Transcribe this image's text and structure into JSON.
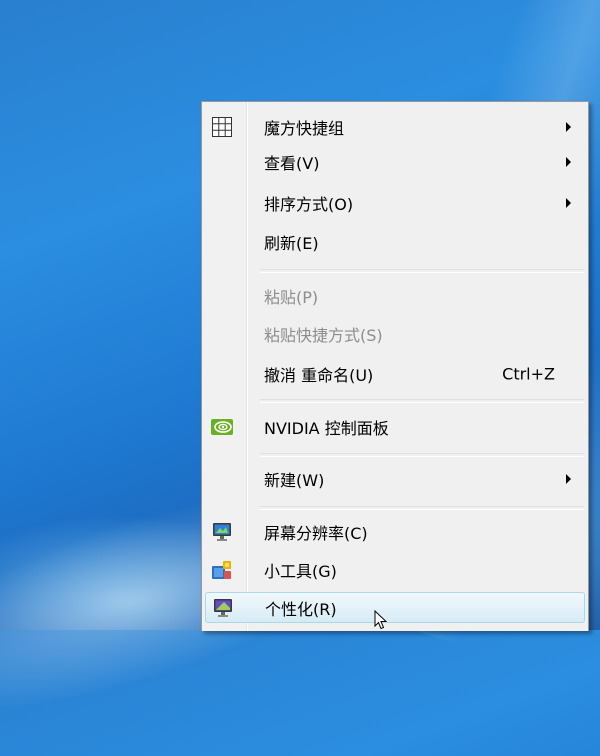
{
  "context_menu": {
    "items": [
      {
        "label": "魔方快捷组",
        "shortcut": "",
        "icon": "grid-icon"
      },
      {
        "label": "查看(V)",
        "shortcut": ""
      },
      {
        "label": "排序方式(O)",
        "shortcut": ""
      },
      {
        "label": "刷新(E)",
        "shortcut": ""
      },
      {
        "label": "粘贴(P)",
        "shortcut": "",
        "disabled": true
      },
      {
        "label": "粘贴快捷方式(S)",
        "shortcut": "",
        "disabled": true
      },
      {
        "label": "撤消 重命名(U)",
        "shortcut": "Ctrl+Z"
      },
      {
        "label": "NVIDIA 控制面板",
        "shortcut": "",
        "icon": "nvidia-icon"
      },
      {
        "label": "新建(W)",
        "shortcut": ""
      },
      {
        "label": "屏幕分辨率(C)",
        "shortcut": "",
        "icon": "monitor-icon"
      },
      {
        "label": "小工具(G)",
        "shortcut": "",
        "icon": "gadgets-icon"
      },
      {
        "label": "个性化(R)",
        "shortcut": "",
        "icon": "personalize-icon"
      }
    ]
  },
  "colors": {
    "desktop_top": "#2b8ee0",
    "desktop_bottom": "#144f9c",
    "menu_bg": "#f0f0f0",
    "hover_border": "#a8d8eb",
    "disabled_text": "#8d8d8d",
    "nvidia_green": "#76b900"
  }
}
